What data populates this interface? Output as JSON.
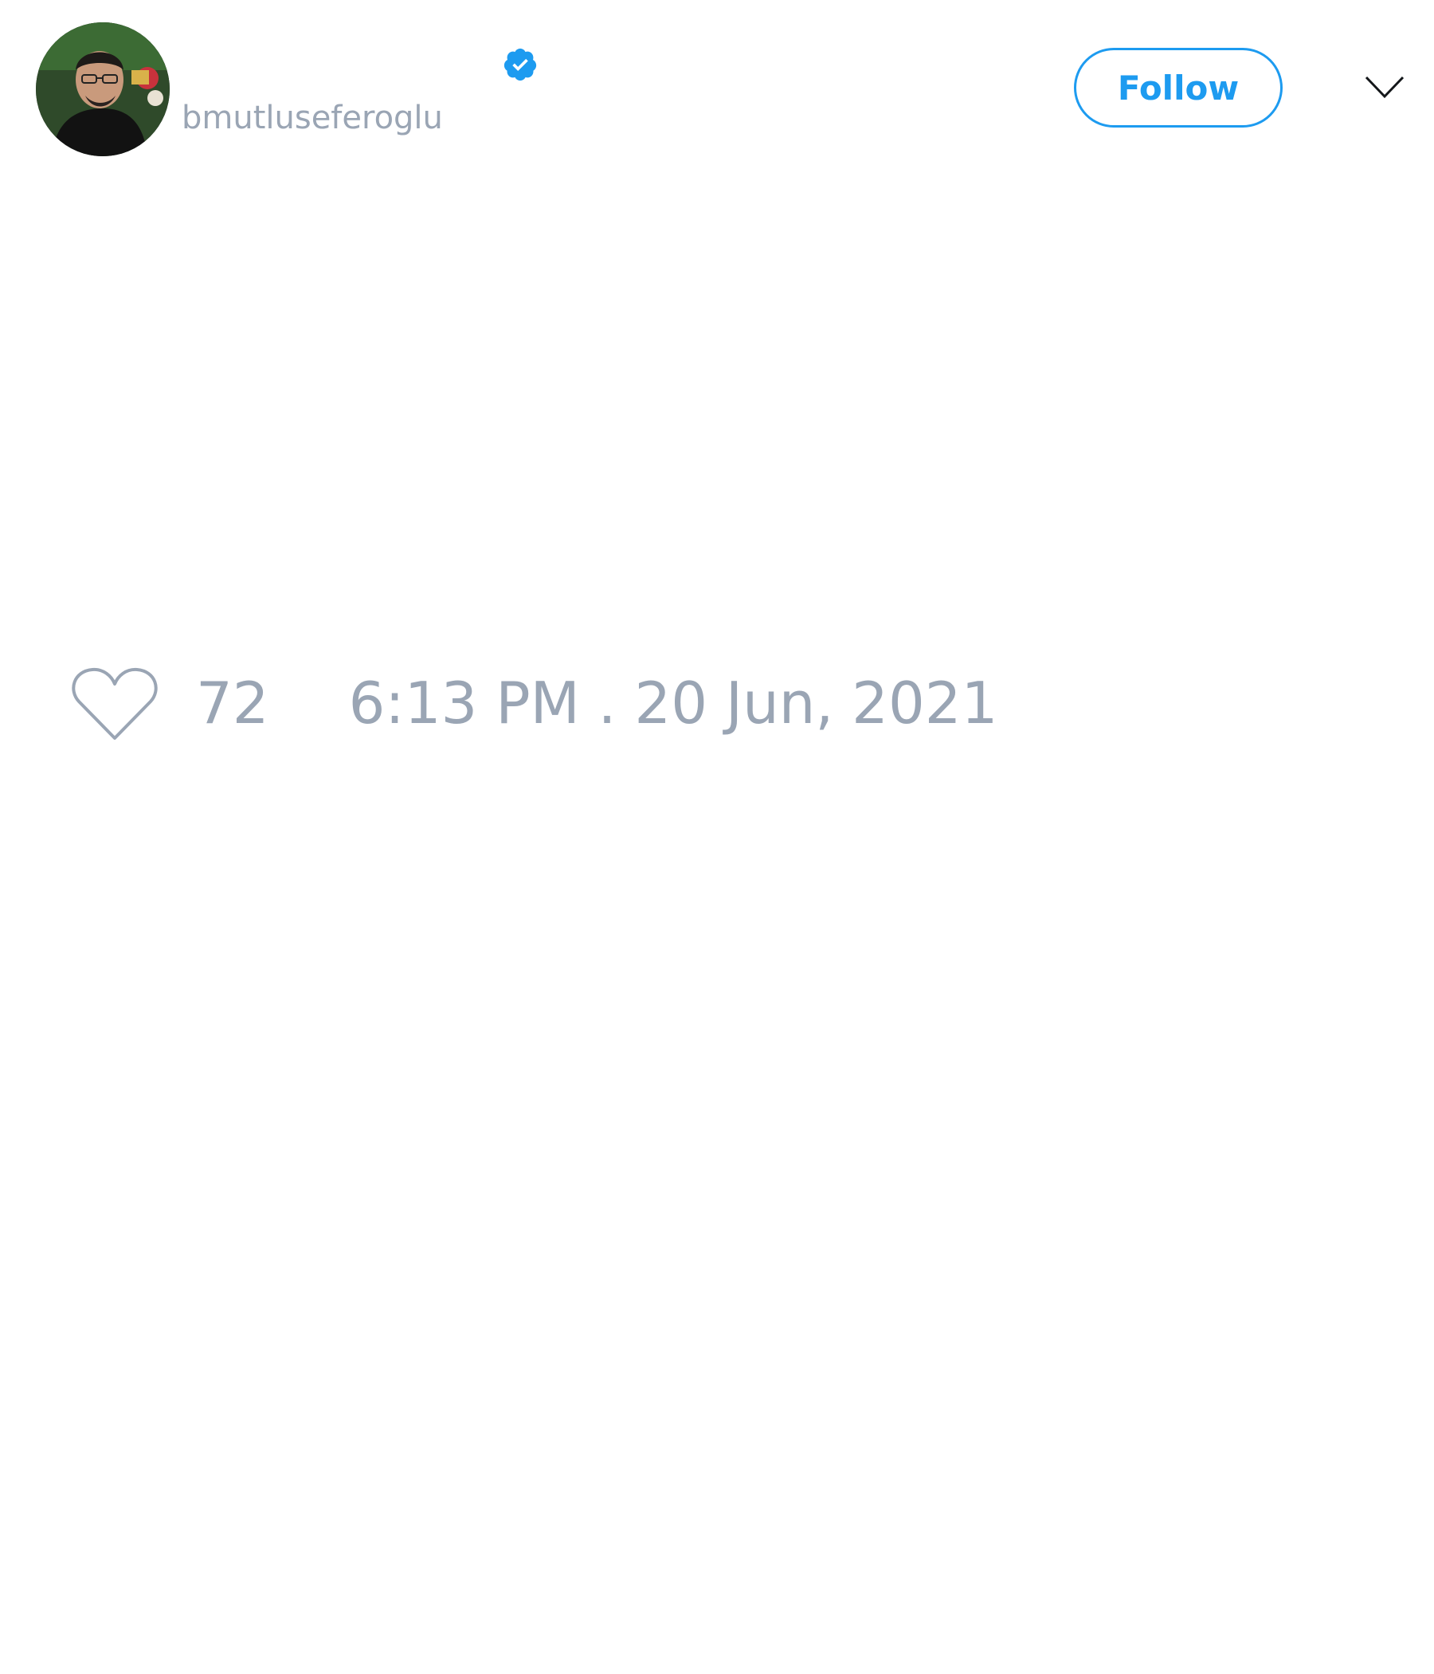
{
  "tweet": {
    "author": {
      "handle": "bmutluseferoglu",
      "verified": true,
      "avatar": "profile-photo"
    },
    "follow_label": "Follow",
    "menu_icon": "chevron-down-icon",
    "like_icon": "heart-outline-icon",
    "like_count": "72",
    "timestamp": "6:13 PM . 20 Jun, 2021"
  },
  "colors": {
    "accent": "#1d9bf0",
    "muted_text": "#9aa5b4",
    "background": "#ffffff"
  }
}
